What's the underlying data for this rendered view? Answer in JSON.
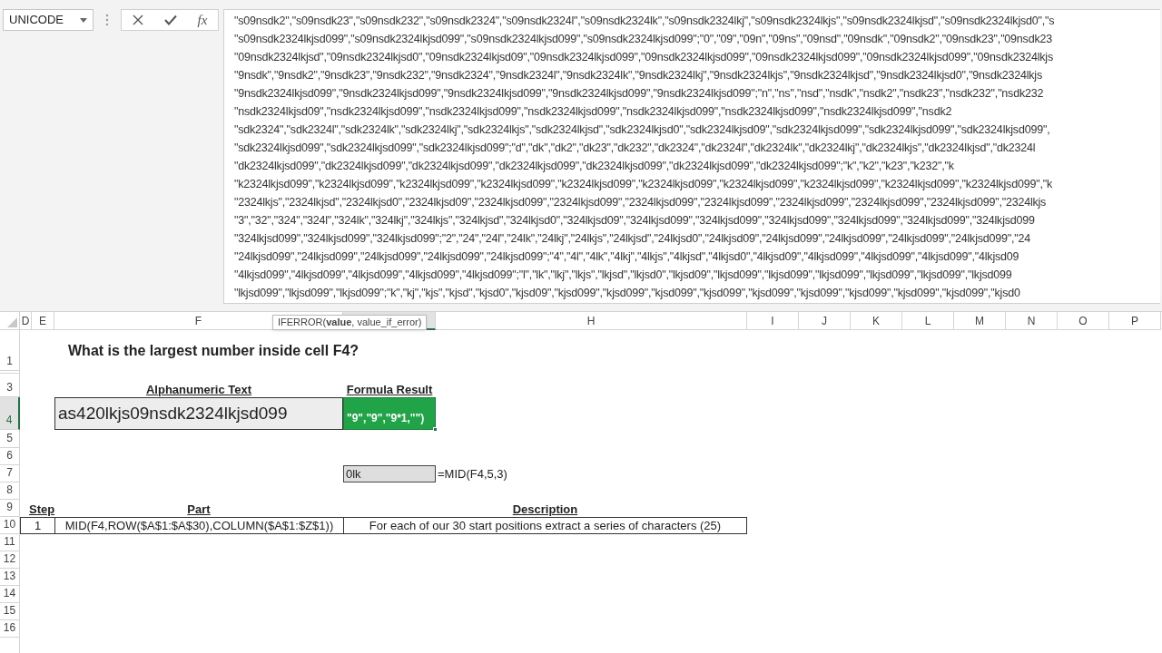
{
  "name_box": {
    "value": "UNICODE"
  },
  "formula_buttons": [
    {
      "kind": "cancel"
    },
    {
      "kind": "enter"
    },
    {
      "kind": "function",
      "label": "fx"
    }
  ],
  "formula_bar": {
    "lines": [
      "\"s09nsdk2\",\"s09nsdk23\",\"s09nsdk232\",\"s09nsdk2324\",\"s09nsdk2324l\",\"s09nsdk2324lk\",\"s09nsdk2324lkj\",\"s09nsdk2324lkjs\",\"s09nsdk2324lkjsd\",\"s09nsdk2324lkjsd0\",\"s",
      "\"s09nsdk2324lkjsd099\",\"s09nsdk2324lkjsd099\",\"s09nsdk2324lkjsd099\",\"s09nsdk2324lkjsd099\";\"0\",\"09\",\"09n\",\"09ns\",\"09nsd\",\"09nsdk\",\"09nsdk2\",\"09nsdk23\",\"09nsdk23",
      "\"09nsdk2324lkjsd\",\"09nsdk2324lkjsd0\",\"09nsdk2324lkjsd09\",\"09nsdk2324lkjsd099\",\"09nsdk2324lkjsd099\",\"09nsdk2324lkjsd099\",\"09nsdk2324lkjsd099\",\"09nsdk2324lkjs",
      "\"9nsdk\",\"9nsdk2\",\"9nsdk23\",\"9nsdk232\",\"9nsdk2324\",\"9nsdk2324l\",\"9nsdk2324lk\",\"9nsdk2324lkj\",\"9nsdk2324lkjs\",\"9nsdk2324lkjsd\",\"9nsdk2324lkjsd0\",\"9nsdk2324lkjs",
      "\"9nsdk2324lkjsd099\",\"9nsdk2324lkjsd099\",\"9nsdk2324lkjsd099\",\"9nsdk2324lkjsd099\",\"9nsdk2324lkjsd099\";\"n\",\"ns\",\"nsd\",\"nsdk\",\"nsdk2\",\"nsdk23\",\"nsdk232\",\"nsdk232",
      "\"nsdk2324lkjsd09\",\"nsdk2324lkjsd099\",\"nsdk2324lkjsd099\",\"nsdk2324lkjsd099\",\"nsdk2324lkjsd099\",\"nsdk2324lkjsd099\",\"nsdk2324lkjsd099\",\"nsdk2",
      "\"sdk2324\",\"sdk2324l\",\"sdk2324lk\",\"sdk2324lkj\",\"sdk2324lkjs\",\"sdk2324lkjsd\",\"sdk2324lkjsd0\",\"sdk2324lkjsd09\",\"sdk2324lkjsd099\",\"sdk2324lkjsd099\",\"sdk2324lkjsd099\",",
      "\"sdk2324lkjsd099\",\"sdk2324lkjsd099\",\"sdk2324lkjsd099\";\"d\",\"dk\",\"dk2\",\"dk23\",\"dk232\",\"dk2324\",\"dk2324l\",\"dk2324lk\",\"dk2324lkj\",\"dk2324lkjs\",\"dk2324lkjsd\",\"dk2324l",
      "\"dk2324lkjsd099\",\"dk2324lkjsd099\",\"dk2324lkjsd099\",\"dk2324lkjsd099\",\"dk2324lkjsd099\",\"dk2324lkjsd099\",\"dk2324lkjsd099\";\"k\",\"k2\",\"k23\",\"k232\",\"k",
      "\"k2324lkjsd099\",\"k2324lkjsd099\",\"k2324lkjsd099\",\"k2324lkjsd099\",\"k2324lkjsd099\",\"k2324lkjsd099\",\"k2324lkjsd099\",\"k2324lkjsd099\",\"k2324lkjsd099\",\"k2324lkjsd099\",\"k",
      "\"2324lkjs\",\"2324lkjsd\",\"2324lkjsd0\",\"2324lkjsd09\",\"2324lkjsd099\",\"2324lkjsd099\",\"2324lkjsd099\",\"2324lkjsd099\",\"2324lkjsd099\",\"2324lkjsd099\",\"2324lkjsd099\",\"2324lkjs",
      "\"3\",\"32\",\"324\",\"324l\",\"324lk\",\"324lkj\",\"324lkjs\",\"324lkjsd\",\"324lkjsd0\",\"324lkjsd09\",\"324lkjsd099\",\"324lkjsd099\",\"324lkjsd099\",\"324lkjsd099\",\"324lkjsd099\",\"324lkjsd099",
      "\"324lkjsd099\",\"324lkjsd099\",\"324lkjsd099\";\"2\",\"24\",\"24l\",\"24lk\",\"24lkj\",\"24lkjs\",\"24lkjsd\",\"24lkjsd0\",\"24lkjsd09\",\"24lkjsd099\",\"24lkjsd099\",\"24lkjsd099\",\"24lkjsd099\",\"24",
      "\"24lkjsd099\",\"24lkjsd099\",\"24lkjsd099\",\"24lkjsd099\",\"24lkjsd099\";\"4\",\"4l\",\"4lk\",\"4lkj\",\"4lkjs\",\"4lkjsd\",\"4lkjsd0\",\"4lkjsd09\",\"4lkjsd099\",\"4lkjsd099\",\"4lkjsd099\",\"4lkjsd09",
      "\"4lkjsd099\",\"4lkjsd099\",\"4lkjsd099\",\"4lkjsd099\",\"4lkjsd099\";\"l\",\"lk\",\"lkj\",\"lkjs\",\"lkjsd\",\"lkjsd0\",\"lkjsd09\",\"lkjsd099\",\"lkjsd099\",\"lkjsd099\",\"lkjsd099\",\"lkjsd099\",\"lkjsd099",
      "\"lkjsd099\",\"lkjsd099\",\"lkjsd099\";\"k\",\"kj\",\"kjs\",\"kjsd\",\"kjsd0\",\"kjsd09\",\"kjsd099\",\"kjsd099\",\"kjsd099\",\"kjsd099\",\"kjsd099\",\"kjsd099\",\"kjsd099\",\"kjsd099\",\"kjsd099\",\"kjsd0"
    ]
  },
  "tooltip": "IFERROR(**value**, value_if_error)",
  "column_headers": [
    "D",
    "E",
    "F",
    "H",
    "I",
    "J",
    "K",
    "L",
    "M",
    "N",
    "O",
    "P"
  ],
  "row_headers": [
    {
      "label": "1",
      "selected": false
    },
    {
      "label": "3",
      "selected": false
    },
    {
      "label": "4",
      "selected": true
    },
    {
      "label": "5",
      "selected": false
    },
    {
      "label": "6",
      "selected": false
    },
    {
      "label": "7",
      "selected": false
    },
    {
      "label": "8",
      "selected": false
    },
    {
      "label": "9",
      "selected": false
    },
    {
      "label": "10",
      "selected": false
    },
    {
      "label": "11",
      "selected": false
    },
    {
      "label": "12",
      "selected": false
    },
    {
      "label": "13",
      "selected": false
    },
    {
      "label": "14",
      "selected": false
    },
    {
      "label": "15",
      "selected": false
    },
    {
      "label": "16",
      "selected": false
    }
  ],
  "sheet": {
    "question": "What is the largest number inside cell F4?",
    "input_heading": "Alphanumeric Text",
    "result_heading": "Formula Result",
    "input_cell": "as420lkjs09nsdk2324lkjsd099",
    "result_cell": "\"9\",\"9\",\"9*1,\"\")",
    "mid_result": "0lk",
    "mid_formula": "=MID(F4,5,3)",
    "steps_table": {
      "columns": [
        "Step",
        "Part",
        "Description"
      ],
      "rows": [
        {
          "step": "1",
          "part": "MID(F4,ROW($A$1:$A$30),COLUMN($A$1:$Z$1))",
          "description": "For each of our 30 start positions extract a series of characters (25)"
        }
      ]
    }
  }
}
